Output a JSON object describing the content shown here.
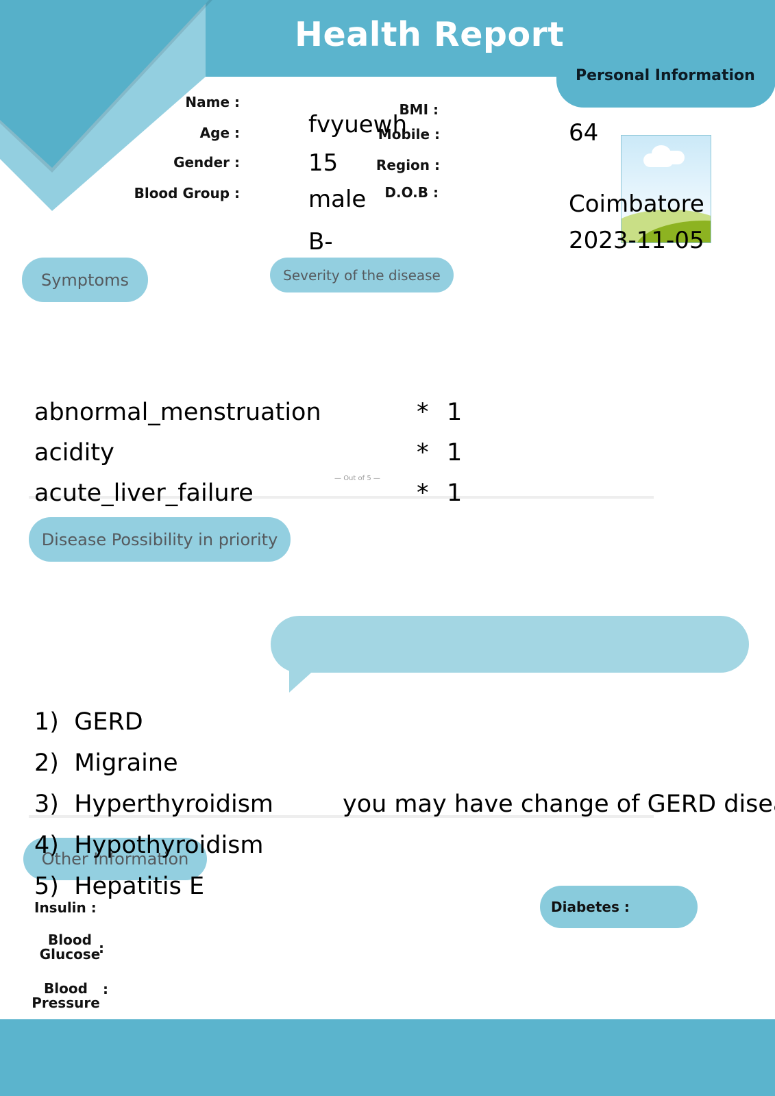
{
  "header": {
    "title": "Health Report",
    "personal_info_tab": "Personal Information"
  },
  "personal": {
    "name_label": "Name :",
    "age_label": "Age :",
    "gender_label": "Gender :",
    "blood_group_label": "Blood Group :",
    "bmi_label": "BMI :",
    "mobile_label": "Mobile :",
    "region_label": "Region :",
    "dob_label": "D.O.B :",
    "name": "fvyuewh",
    "age": "15",
    "gender": "male",
    "blood_group": "B-",
    "bmi": "64",
    "region": "Coimbatore",
    "dob": "2023-11-05"
  },
  "sections": {
    "symptoms": "Symptoms",
    "severity": "Severity of the disease",
    "out_of": "Out of 5",
    "disease_possibility": "Disease Possibility in priority",
    "other_information": "Other Information"
  },
  "symptoms": [
    {
      "name": "abnormal_menstruation",
      "star": "*",
      "severity": "1"
    },
    {
      "name": "acidity",
      "star": "*",
      "severity": "1"
    },
    {
      "name": "acute_liver_failure",
      "star": "*",
      "severity": "1"
    }
  ],
  "diseases": [
    {
      "rank": "1)",
      "name": "GERD"
    },
    {
      "rank": "2)",
      "name": "Migraine"
    },
    {
      "rank": "3)",
      "name": "Hyperthyroidism"
    },
    {
      "rank": "4)",
      "name": "Hypothyroidism"
    },
    {
      "rank": "5)",
      "name": "Hepatitis E"
    }
  ],
  "prediction_message": "you may have change of GERD disease",
  "other": {
    "insulin_label": "Insulin :",
    "blood_glucose_label_1": "Blood",
    "blood_glucose_label_2": "Glucose",
    "blood_glucose_colon": ":",
    "blood_pressure_label_1": "Blood",
    "blood_pressure_label_2": "Pressure",
    "blood_pressure_colon": ":",
    "diabetes_label": "Diabetes :"
  },
  "colors": {
    "brand_blue": "#5bb4cd",
    "pill_blue": "#93cfe0",
    "bubble_blue": "#a3d6e3"
  }
}
